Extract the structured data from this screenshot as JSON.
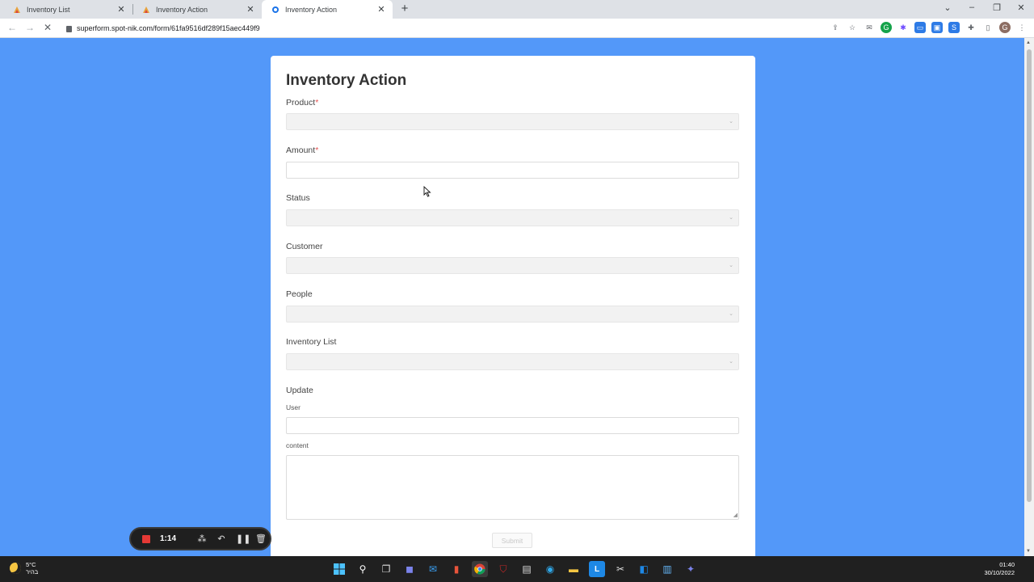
{
  "browser": {
    "tabs": [
      {
        "label": "Inventory List",
        "favicon_color": "#e8a33d"
      },
      {
        "label": "Inventory Action",
        "favicon_color": "#e8a33d"
      },
      {
        "label": "Inventory Action",
        "favicon_color": "#1a73e8"
      }
    ],
    "url": "superform.spot-nik.com/form/61fa9516df289f15aec449f9"
  },
  "form": {
    "title": "Inventory Action",
    "required_marker": "*",
    "fields": {
      "product": {
        "label": "Product"
      },
      "amount": {
        "label": "Amount"
      },
      "status": {
        "label": "Status"
      },
      "customer": {
        "label": "Customer"
      },
      "people": {
        "label": "People"
      },
      "inventory_list": {
        "label": "Inventory List"
      },
      "update": {
        "label": "Update",
        "user_label": "User",
        "content_label": "content"
      }
    },
    "submit_label": "Submit"
  },
  "recorder": {
    "time": "1:14"
  },
  "taskbar": {
    "temperature": "5°C",
    "weather_text": "בהיר",
    "time": "01:40",
    "date": "30/10/2022"
  }
}
